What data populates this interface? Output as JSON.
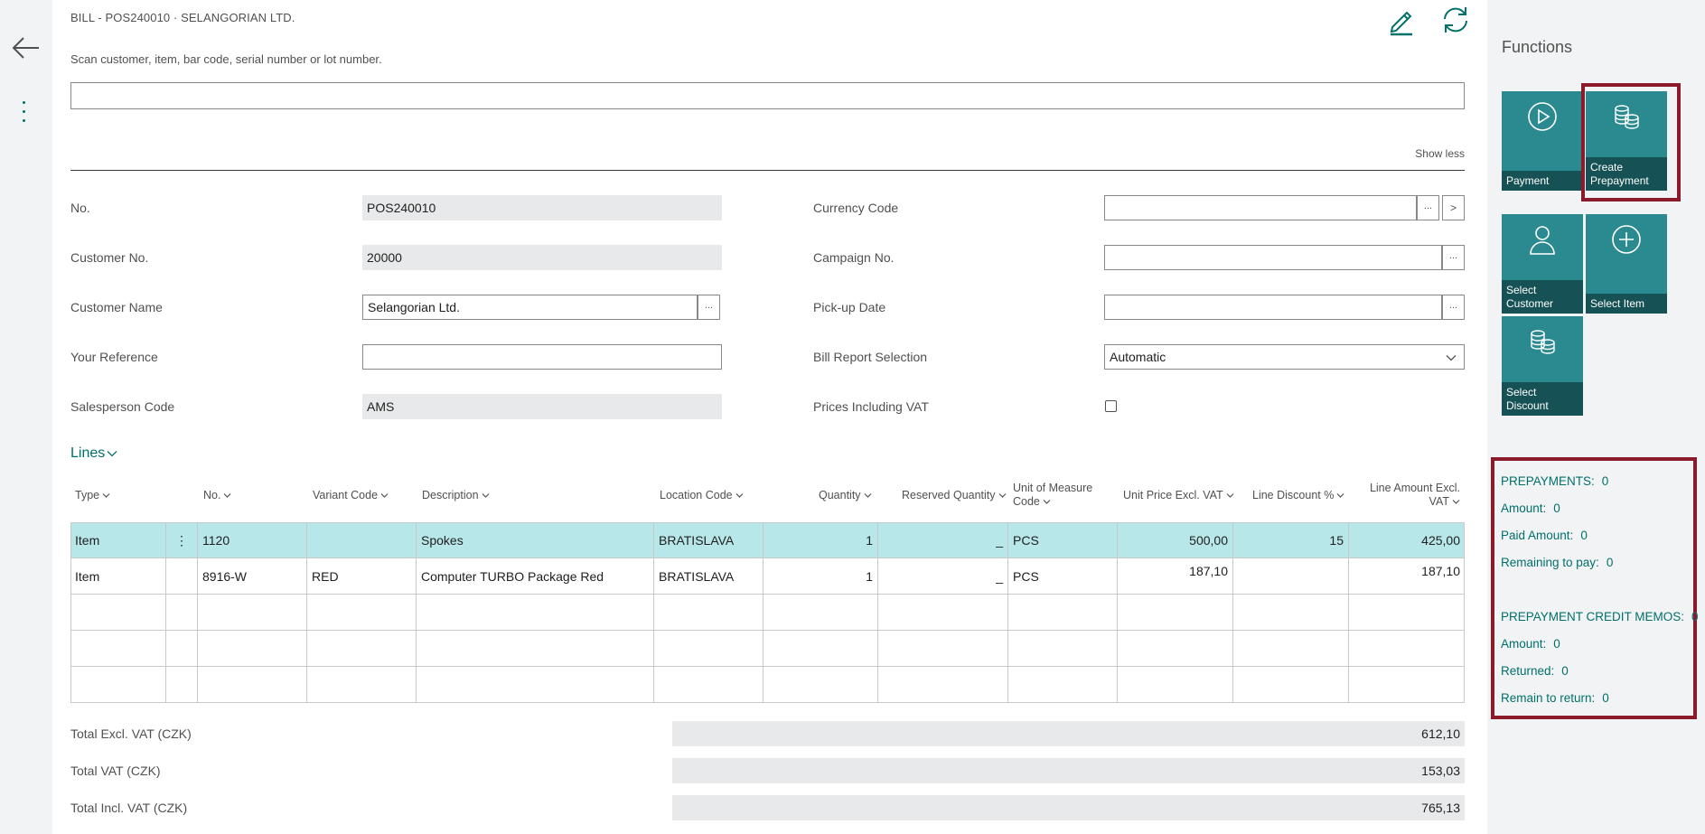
{
  "page": {
    "title": "BILL - POS240010 · SELANGORIAN LTD.",
    "scan_label": "Scan customer, item, bar code, serial number or lot number.",
    "scan_value": "",
    "show_less": "Show less"
  },
  "icons": {
    "back": "back-arrow-icon",
    "more": "more-vertical-icon",
    "edit": "pencil-icon",
    "refresh": "refresh-icon"
  },
  "fields_left": [
    {
      "label": "No.",
      "value": "POS240010",
      "editable": false
    },
    {
      "label": "Customer No.",
      "value": "20000",
      "editable": false
    },
    {
      "label": "Customer Name",
      "value": "Selangorian Ltd.",
      "editable": true
    },
    {
      "label": "Your Reference",
      "value": "",
      "editable": true
    },
    {
      "label": "Salesperson Code",
      "value": "AMS",
      "editable": false
    }
  ],
  "fields_right": [
    {
      "label": "Currency Code",
      "value": ""
    },
    {
      "label": "Campaign No.",
      "value": ""
    },
    {
      "label": "Pick-up Date",
      "value": ""
    },
    {
      "label": "Bill Report Selection",
      "value": "Automatic"
    },
    {
      "label": "Prices Including VAT",
      "checked": false
    }
  ],
  "buttons": {
    "ellipsis": "...",
    "drill": ">"
  },
  "lines": {
    "title": "Lines",
    "columns": [
      "Type",
      "No.",
      "Variant Code",
      "Description",
      "Location Code",
      "Quantity",
      "Reserved Quantity",
      "Unit of Measure Code",
      "Unit Price Excl. VAT",
      "Line Discount %",
      "Line Amount Excl. VAT"
    ],
    "col_uom_1": "Unit of Measure",
    "col_uom_2": "Code",
    "col_amt_1": "Line Amount Excl.",
    "col_amt_2": "VAT",
    "rows": [
      {
        "type": "Item",
        "no": "1120",
        "variant": "",
        "description": "Spokes",
        "location": "BRATISLAVA",
        "quantity": "1",
        "reserved": "_",
        "uom": "PCS",
        "unit_price": "500,00",
        "discount": "15",
        "amount": "425,00"
      },
      {
        "type": "Item",
        "no": "8916-W",
        "variant": "RED",
        "description": "Computer TURBO Package Red",
        "location": "BRATISLAVA",
        "quantity": "1",
        "reserved": "_",
        "uom": "PCS",
        "unit_price": "187,10",
        "discount": "",
        "amount": "187,10"
      }
    ],
    "row_menu": "⋮"
  },
  "totals": [
    {
      "label": "Total Excl. VAT (CZK)",
      "value": "612,10"
    },
    {
      "label": "Total VAT (CZK)",
      "value": "153,03"
    },
    {
      "label": "Total Incl. VAT (CZK)",
      "value": "765,13"
    }
  ],
  "functions": {
    "title": "Functions",
    "tiles": [
      {
        "label": "Payment",
        "icon": "play-circle-icon"
      },
      {
        "label": "Create Prepayment",
        "icon": "coins-icon"
      },
      {
        "label": "Select Customer",
        "icon": "person-icon"
      },
      {
        "label": "Select Item",
        "icon": "plus-circle-icon"
      },
      {
        "label": "Select Discount",
        "icon": "coins-icon"
      }
    ]
  },
  "prepayments": {
    "prepayments_label": "PREPAYMENTS:",
    "prepayments_value": "0",
    "amount_label": "Amount:",
    "amount_value": "0",
    "paid_label": "Paid Amount:",
    "paid_value": "0",
    "remaining_label": "Remaining to pay:",
    "remaining_value": "0",
    "credit_label": "PREPAYMENT CREDIT MEMOS:",
    "credit_value": "0",
    "credit_amount_label": "Amount:",
    "credit_amount_value": "0",
    "returned_label": "Returned:",
    "returned_value": "0",
    "remain_return_label": "Remain to return:",
    "remain_return_value": "0"
  },
  "colors": {
    "accent": "#00706b",
    "tile": "#2b8a8f",
    "tile_label": "#165155",
    "selected_row": "#b8e7ea",
    "highlight": "#8b1a2b"
  }
}
